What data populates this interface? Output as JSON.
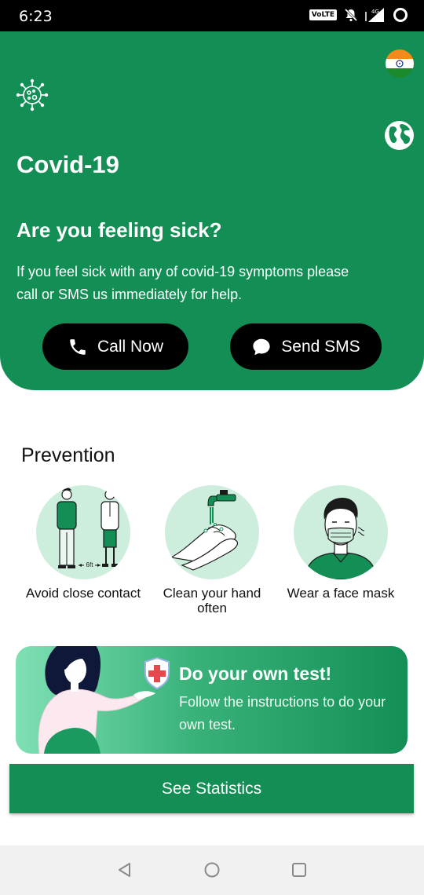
{
  "status_bar": {
    "time": "6:23",
    "volte": "VoLTE",
    "network": "4G"
  },
  "header": {
    "title": "Covid-19",
    "sick_title": "Are you feeling sick?",
    "sick_desc": "If you feel sick with any of covid-19 symptoms please call or SMS us immediately for help.",
    "call_label": "Call Now",
    "sms_label": "Send SMS",
    "bg_color": "#138f55"
  },
  "prevention": {
    "title": "Prevention",
    "items": [
      {
        "label": "Avoid close contact",
        "icon": "social-distance-icon",
        "distance": "6ft"
      },
      {
        "label": "Clean your hand often",
        "icon": "hand-wash-icon"
      },
      {
        "label": "Wear a face mask",
        "icon": "face-mask-icon"
      }
    ]
  },
  "test_banner": {
    "title": "Do your own test!",
    "desc": "Follow the instructions to do your own test."
  },
  "stats_button": {
    "label": "See Statistics"
  },
  "colors": {
    "primary": "#138f55",
    "light": "#cdeedd",
    "black": "#000000"
  }
}
